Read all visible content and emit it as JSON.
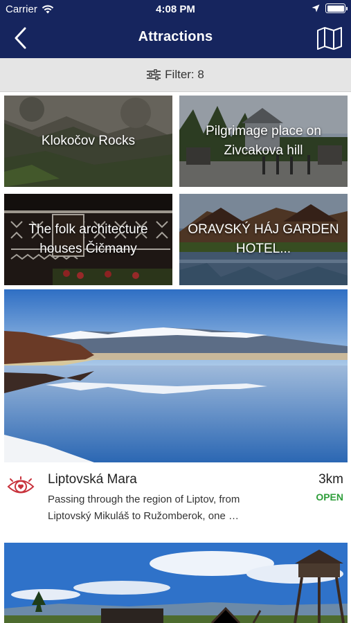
{
  "status_bar": {
    "carrier": "Carrier",
    "time": "4:08 PM"
  },
  "header": {
    "title": "Attractions",
    "back_icon": "chevron-left-icon",
    "map_icon": "map-icon"
  },
  "filter": {
    "label": "Filter: 8",
    "icon": "sliders-icon"
  },
  "tiles": [
    {
      "label": "Klokočov Rocks"
    },
    {
      "label": "Pilgrimage place on Zivcakova hill"
    },
    {
      "label": "The folk architecture houses Čičmany"
    },
    {
      "label": "ORAVSKÝ HÁJ GARDEN HOTEL..."
    }
  ],
  "featured": {
    "title": "Liptovská Mara",
    "description": "Passing through the region of Liptov, from Liptovský Mikuláš to Ružomberok, one …",
    "distance": "3km",
    "status": "OPEN",
    "icon": "eye-heart-icon"
  },
  "colors": {
    "navbar": "#16255e",
    "open": "#2e9e3a",
    "accent": "#c8323c"
  }
}
